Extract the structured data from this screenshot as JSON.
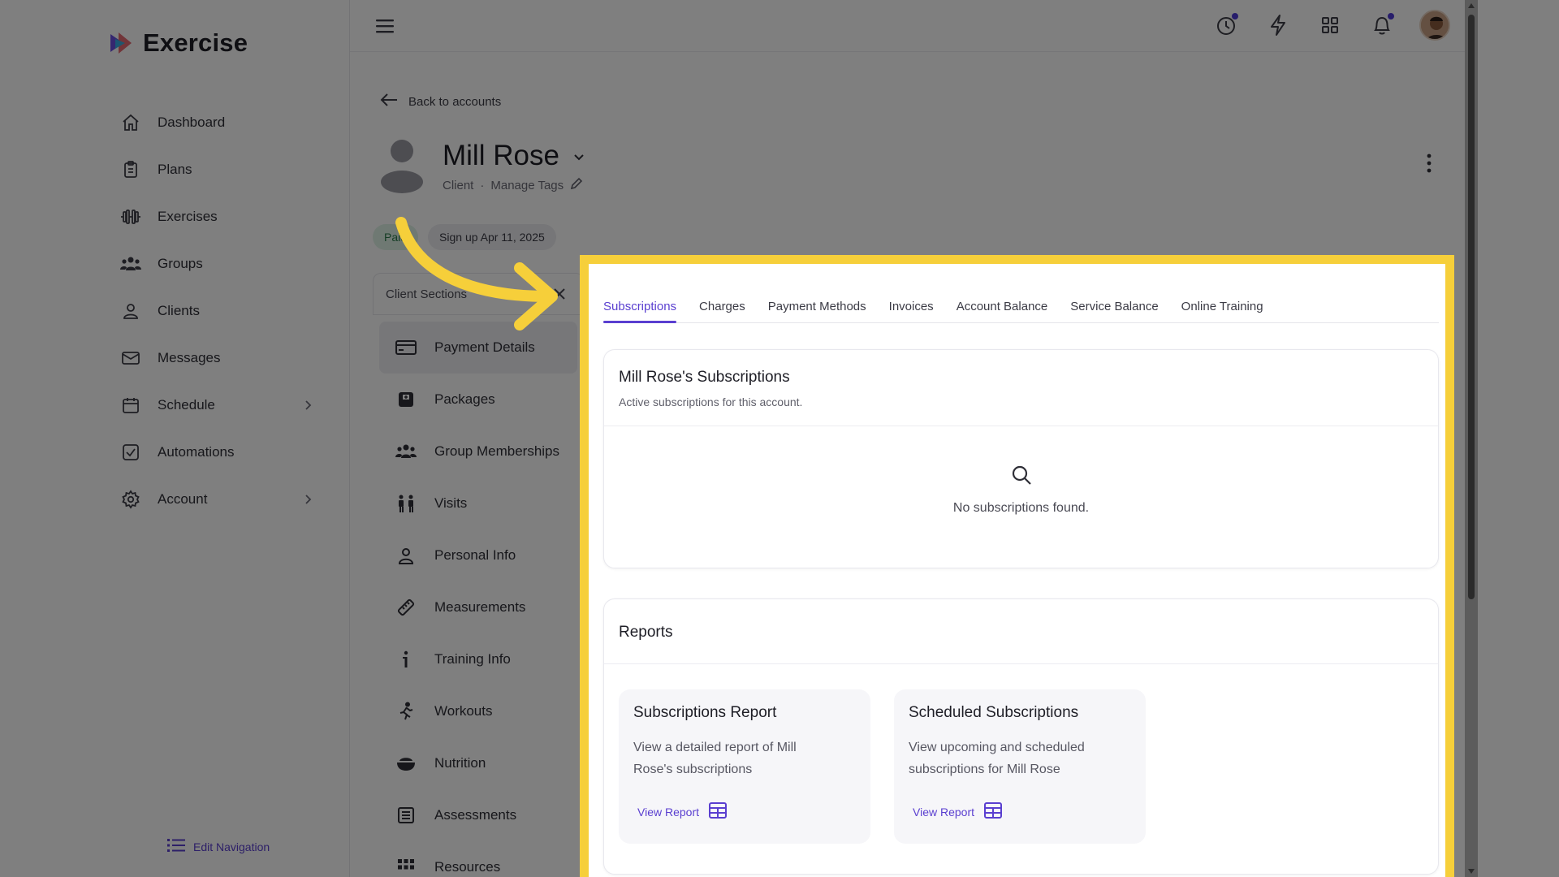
{
  "app": {
    "name": "Exercise"
  },
  "sidebar": {
    "items": [
      {
        "label": "Dashboard",
        "icon": "home-icon"
      },
      {
        "label": "Plans",
        "icon": "clipboard-icon"
      },
      {
        "label": "Exercises",
        "icon": "dumbbell-icon"
      },
      {
        "label": "Groups",
        "icon": "group-icon"
      },
      {
        "label": "Clients",
        "icon": "user-icon"
      },
      {
        "label": "Messages",
        "icon": "mail-icon"
      },
      {
        "label": "Schedule",
        "icon": "calendar-icon",
        "has_children": true
      },
      {
        "label": "Automations",
        "icon": "checkbox-icon"
      },
      {
        "label": "Account",
        "icon": "gear-icon",
        "has_children": true
      }
    ],
    "edit_nav": "Edit Navigation"
  },
  "topbar": {
    "icons": [
      "history-icon",
      "lightning-icon",
      "apps-grid-icon",
      "bell-icon"
    ]
  },
  "profile": {
    "back_label": "Back to accounts",
    "name": "Mill Rose",
    "role": "Client",
    "separator": "·",
    "manage_tags": "Manage Tags",
    "chip_paid": "Paid",
    "chip_signup": "Sign up Apr 11, 2025"
  },
  "client_sections": {
    "header": "Client Sections",
    "items": [
      {
        "label": "Payment Details",
        "icon": "credit-card-icon",
        "active": true
      },
      {
        "label": "Packages",
        "icon": "package-icon"
      },
      {
        "label": "Group Memberships",
        "icon": "group-icon"
      },
      {
        "label": "Visits",
        "icon": "visits-icon"
      },
      {
        "label": "Personal Info",
        "icon": "user-icon"
      },
      {
        "label": "Measurements",
        "icon": "ruler-icon"
      },
      {
        "label": "Training Info",
        "icon": "info-icon"
      },
      {
        "label": "Workouts",
        "icon": "running-icon"
      },
      {
        "label": "Nutrition",
        "icon": "bowl-icon"
      },
      {
        "label": "Assessments",
        "icon": "list-icon"
      },
      {
        "label": "Resources",
        "icon": "grid-icon"
      }
    ]
  },
  "tabs": [
    {
      "label": "Subscriptions",
      "active": true
    },
    {
      "label": "Charges"
    },
    {
      "label": "Payment Methods"
    },
    {
      "label": "Invoices"
    },
    {
      "label": "Account Balance"
    },
    {
      "label": "Service Balance"
    },
    {
      "label": "Online Training"
    }
  ],
  "subscriptions": {
    "title": "Mill Rose's Subscriptions",
    "description": "Active subscriptions for this account.",
    "empty_text": "No subscriptions found."
  },
  "reports": {
    "title": "Reports",
    "cards": [
      {
        "title": "Subscriptions Report",
        "description": "View a detailed report of Mill Rose's subscriptions",
        "link": "View Report"
      },
      {
        "title": "Scheduled Subscriptions",
        "description": "View upcoming and scheduled subscriptions for Mill Rose",
        "link": "View Report"
      }
    ]
  },
  "colors": {
    "accent": "#5a3fd0",
    "highlight": "#f6cf3a",
    "dot": "#4f3bd6"
  }
}
